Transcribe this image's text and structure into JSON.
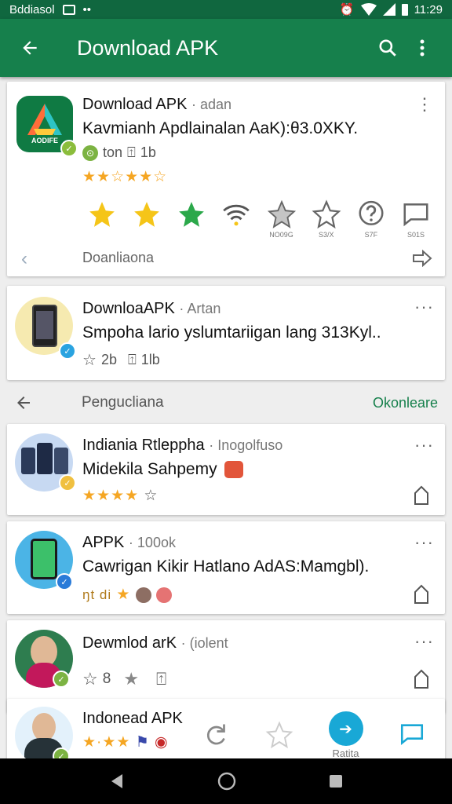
{
  "status_bar": {
    "carrier": "Bddiasol",
    "time": "11:29"
  },
  "app_bar": {
    "title": "Download APK"
  },
  "featured": {
    "name": "Download APK",
    "developer": "adan",
    "description": "Kavmianh Apdlainalan AaK):θ3.0XKY.",
    "meta_a": "ton",
    "meta_b": "1b",
    "icon_text": "AODIFE",
    "big_icons": [
      {
        "name": "star-icon",
        "label": ""
      },
      {
        "name": "star-icon",
        "label": ""
      },
      {
        "name": "star-icon",
        "label": ""
      },
      {
        "name": "wifi-icon",
        "label": ""
      },
      {
        "name": "star-outline-icon",
        "label": "NO09G"
      },
      {
        "name": "star-outline-icon",
        "label": "S3/X"
      },
      {
        "name": "help-icon",
        "label": "S7F"
      },
      {
        "name": "chat-icon",
        "label": "S01S"
      }
    ],
    "footer_label": "Doanliaona"
  },
  "second": {
    "name": "DownloaAPK",
    "developer": "Artan",
    "description": "Smpoha lario yslumtariigan lang 313Kyl..",
    "meta_a": "2b",
    "meta_b": "1lb"
  },
  "section": {
    "title": "Pengucliana",
    "action": "Okonleare"
  },
  "list": [
    {
      "name": "Indiania Rtleppha",
      "developer": "Inogolfuso",
      "description": "Midekila Sahpemy",
      "stars": 4
    },
    {
      "name": "APPK",
      "developer": "100ok",
      "description": "Cawrigan Kikir Hatlano AdAS:Mamgbl).",
      "stars": 1,
      "star_prefix": "ŋt di"
    },
    {
      "name": "Dewmlod arK",
      "developer": "(iolent",
      "description": "",
      "meta_a": "8"
    },
    {
      "name": "Indonead APK",
      "developer": "",
      "description": "",
      "stars": 3
    }
  ],
  "overlay_label": "Ratita",
  "colors": {
    "primary": "#16804c",
    "status": "#10673f",
    "star": "#f5a623",
    "green_star": "#2ba84a"
  }
}
